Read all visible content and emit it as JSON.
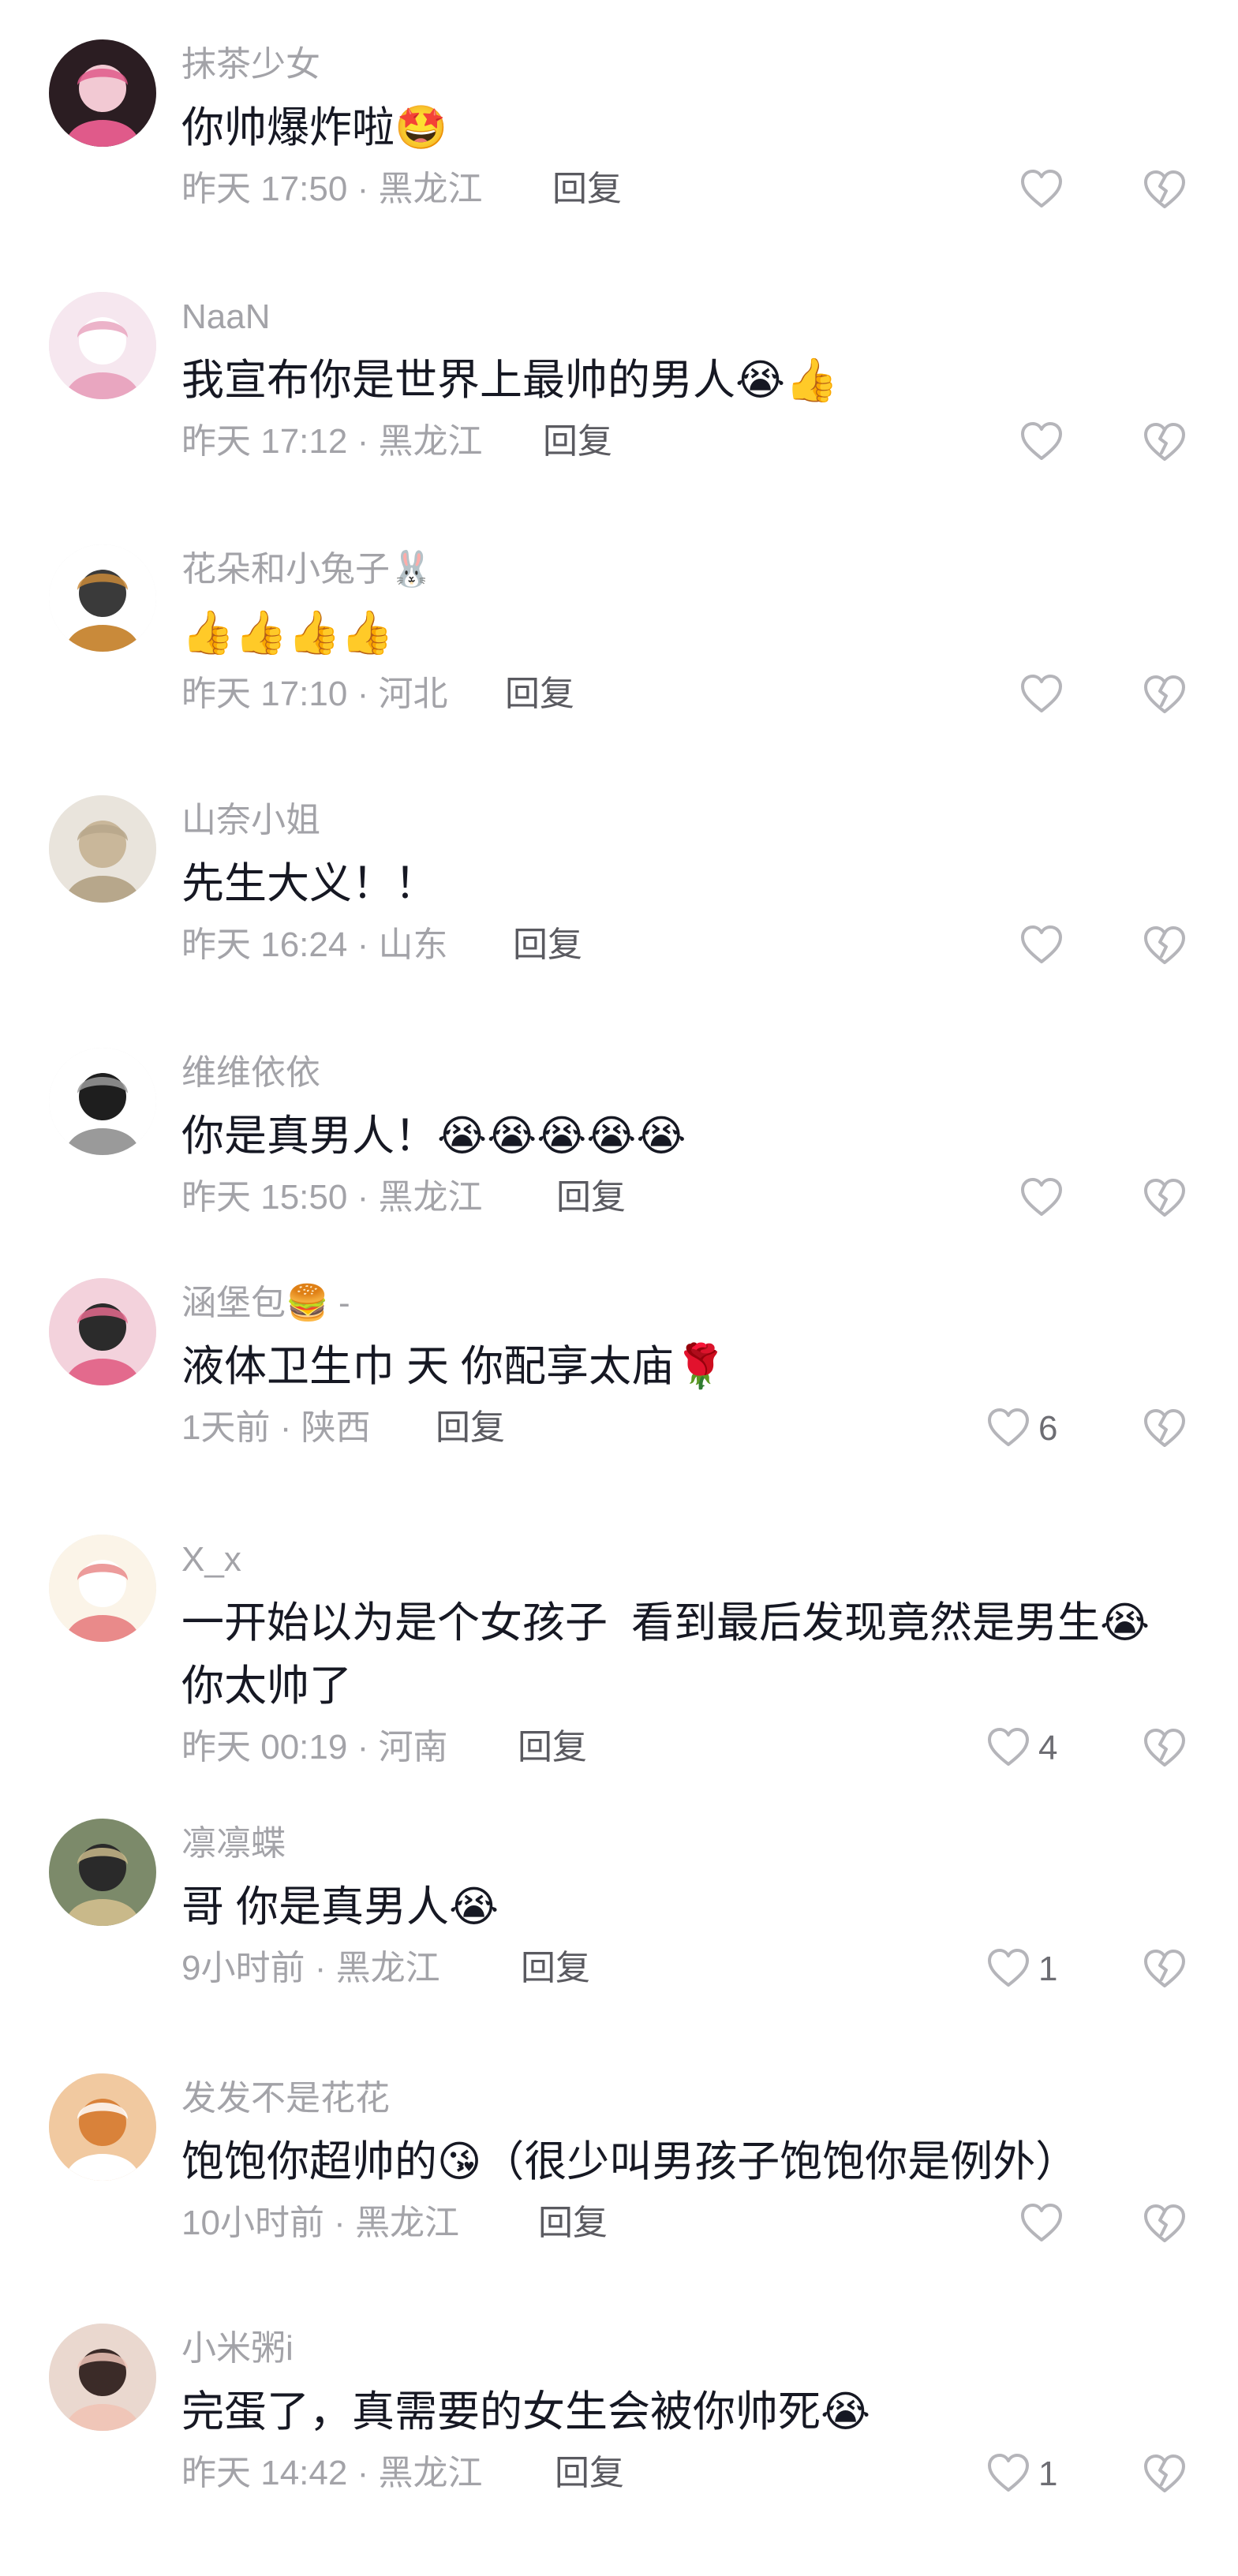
{
  "comments": [
    {
      "username": "抹茶少女",
      "text": "你帅爆炸啦🤩",
      "time": "昨天 17:50",
      "location": "黑龙江",
      "reply": "回复",
      "likes": "",
      "avatar": {
        "bg": "#2b1d22",
        "fg": "#f2c9d3",
        "accent": "#e05a8a"
      }
    },
    {
      "username": "NaaN",
      "text": "我宣布你是世界上最帅的男人😭👍",
      "time": "昨天 17:12",
      "location": "黑龙江",
      "reply": "回复",
      "likes": "",
      "avatar": {
        "bg": "#f6e7ef",
        "fg": "#ffffff",
        "accent": "#e9a6c0"
      }
    },
    {
      "username": "花朵和小兔子🐰",
      "text": "👍👍👍👍",
      "time": "昨天 17:10",
      "location": "河北",
      "reply": "回复",
      "likes": "",
      "avatar": {
        "bg": "#ffffff",
        "fg": "#3a3a3a",
        "accent": "#c98a3a"
      }
    },
    {
      "username": "山奈小姐",
      "text": "先生大义！！",
      "time": "昨天 16:24",
      "location": "山东",
      "reply": "回复",
      "likes": "",
      "avatar": {
        "bg": "#e9e4dc",
        "fg": "#c9b79a",
        "accent": "#b7a78b"
      }
    },
    {
      "username": "维维依依",
      "text": "你是真男人！😭😭😭😭😭",
      "time": "昨天 15:50",
      "location": "黑龙江",
      "reply": "回复",
      "likes": "",
      "avatar": {
        "bg": "#ffffff",
        "fg": "#1e1e1e",
        "accent": "#9a9a9a"
      }
    },
    {
      "username": "涵堡包🍔 -",
      "text": "液体卫生巾 天 你配享太庙🌹",
      "time": "1天前",
      "location": "陕西",
      "reply": "回复",
      "likes": "6",
      "avatar": {
        "bg": "#f3d2dc",
        "fg": "#2b2b2b",
        "accent": "#e36a8d"
      }
    },
    {
      "username": "X_x",
      "text": "一开始以为是个女孩子  看到最后发现竟然是男生😭你太帅了",
      "time": "昨天 00:19",
      "location": "河南",
      "reply": "回复",
      "likes": "4",
      "avatar": {
        "bg": "#fbf4e8",
        "fg": "#ffffff",
        "accent": "#e98a8a"
      }
    },
    {
      "username": "凛凛蝶",
      "text": "哥 你是真男人😭",
      "time": "9小时前",
      "location": "黑龙江",
      "reply": "回复",
      "likes": "1",
      "avatar": {
        "bg": "#7c8a6a",
        "fg": "#2a2a2a",
        "accent": "#c9b98a"
      }
    },
    {
      "username": "发发不是花花",
      "text": "饱饱你超帅的😘（很少叫男孩子饱饱你是例外）",
      "time": "10小时前",
      "location": "黑龙江",
      "reply": "回复",
      "likes": "",
      "avatar": {
        "bg": "#f1c9a0",
        "fg": "#d9823a",
        "accent": "#ffffff"
      }
    },
    {
      "username": "小米粥i",
      "text": "完蛋了，真需要的女生会被你帅死😭",
      "time": "昨天 14:42",
      "location": "黑龙江",
      "reply": "回复",
      "likes": "1",
      "avatar": {
        "bg": "#ead8cf",
        "fg": "#3b2b28",
        "accent": "#f0c6b8"
      }
    }
  ],
  "icons": {
    "like": "heart-outline-icon",
    "dislike": "broken-heart-icon"
  },
  "colors": {
    "primary_text": "#161823",
    "secondary_text": "#a3a3a8",
    "reply_text": "#5a5a60",
    "icon": "#b5b5ba"
  }
}
